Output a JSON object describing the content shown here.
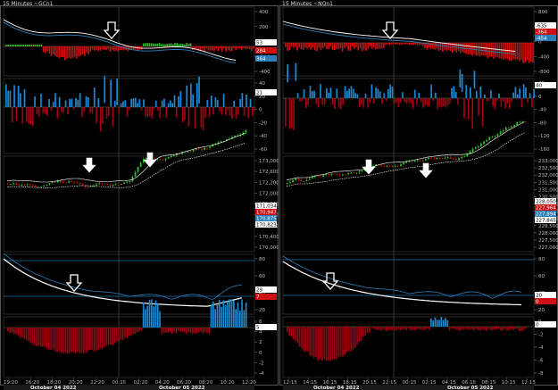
{
  "charts": [
    {
      "title": "15 Minutes ~GCn1",
      "panels": {
        "macd": {
          "ticks": [
            "400",
            "200",
            "0",
            "-200",
            "-400"
          ],
          "flags": [
            "53",
            "284",
            "364"
          ]
        },
        "vol": {
          "ticks": [
            "40",
            "20",
            "0",
            "-20",
            "-40",
            "-60"
          ],
          "flags": [
            "21"
          ]
        },
        "price": {
          "ticks": [
            "173,000",
            "172,600",
            "172,200",
            "172,000",
            "171,600",
            "171,200",
            "170,800",
            "170,400",
            "170,000"
          ],
          "flags": [
            "171,034",
            "170,947",
            "170,875",
            "170,823"
          ]
        },
        "osc": {
          "ticks": [
            "80",
            "60",
            "40",
            "20"
          ],
          "flags": [
            "29",
            "7"
          ]
        },
        "hist": {
          "ticks": [
            "6",
            "4",
            "2",
            "0",
            "-2",
            "-4"
          ],
          "flags": [
            "5"
          ]
        }
      },
      "time_labels": [
        "19:20",
        "16:20",
        "18:20",
        "20:20",
        "22:20",
        "00:15",
        "02:20",
        "04:20",
        "06:20",
        "08:20",
        "10:20",
        "12:20"
      ],
      "date_labels": [
        "October 04 2022",
        "October 05 2022"
      ],
      "colors": {
        "up": "#2fbf2f",
        "down": "#d01010",
        "hist_pos": "#1a8ad4",
        "hist_neg": "#a00010",
        "line_white": "#ffffff",
        "line_blue": "#2a7fb8"
      }
    },
    {
      "title": "15 Minutes ~NQn1",
      "panels": {
        "macd": {
          "ticks": [
            "800",
            "400",
            "0",
            "-400",
            "-800"
          ],
          "flags": [
            "-635",
            "-364",
            "-454"
          ]
        },
        "vol": {
          "ticks": [
            "40",
            "0",
            "-40",
            "-80",
            "-120",
            "-160"
          ],
          "flags": [
            "40"
          ]
        },
        "price": {
          "ticks": [
            "233,000",
            "232,500",
            "232,000",
            "231,500",
            "231,000",
            "230,500",
            "230,000",
            "229,500",
            "229,000",
            "228,500",
            "228,000",
            "227,500",
            "227,000"
          ],
          "flags": [
            "228,050",
            "227,964",
            "227,894",
            "227,845"
          ]
        },
        "osc": {
          "ticks": [
            "80",
            "60",
            "40",
            "20"
          ],
          "flags": [
            "20",
            "0"
          ]
        },
        "hist": {
          "ticks": [
            "0",
            "-2",
            "-4",
            "-6",
            "-8"
          ],
          "flags": [
            "0"
          ]
        }
      },
      "time_labels": [
        "12:15",
        "14:15",
        "16:15",
        "18:15",
        "20:15",
        "22:15",
        "00:15",
        "02:15",
        "04:15",
        "06:15",
        "08:15",
        "10:15",
        "12:15"
      ],
      "date_labels": [
        "October 04 2022",
        "October 05 2022"
      ],
      "colors": {
        "up": "#2fbf2f",
        "down": "#d01010",
        "hist_pos": "#1a8ad4",
        "hist_neg": "#a00010",
        "line_white": "#ffffff",
        "line_blue": "#2a7fb8"
      }
    }
  ]
}
